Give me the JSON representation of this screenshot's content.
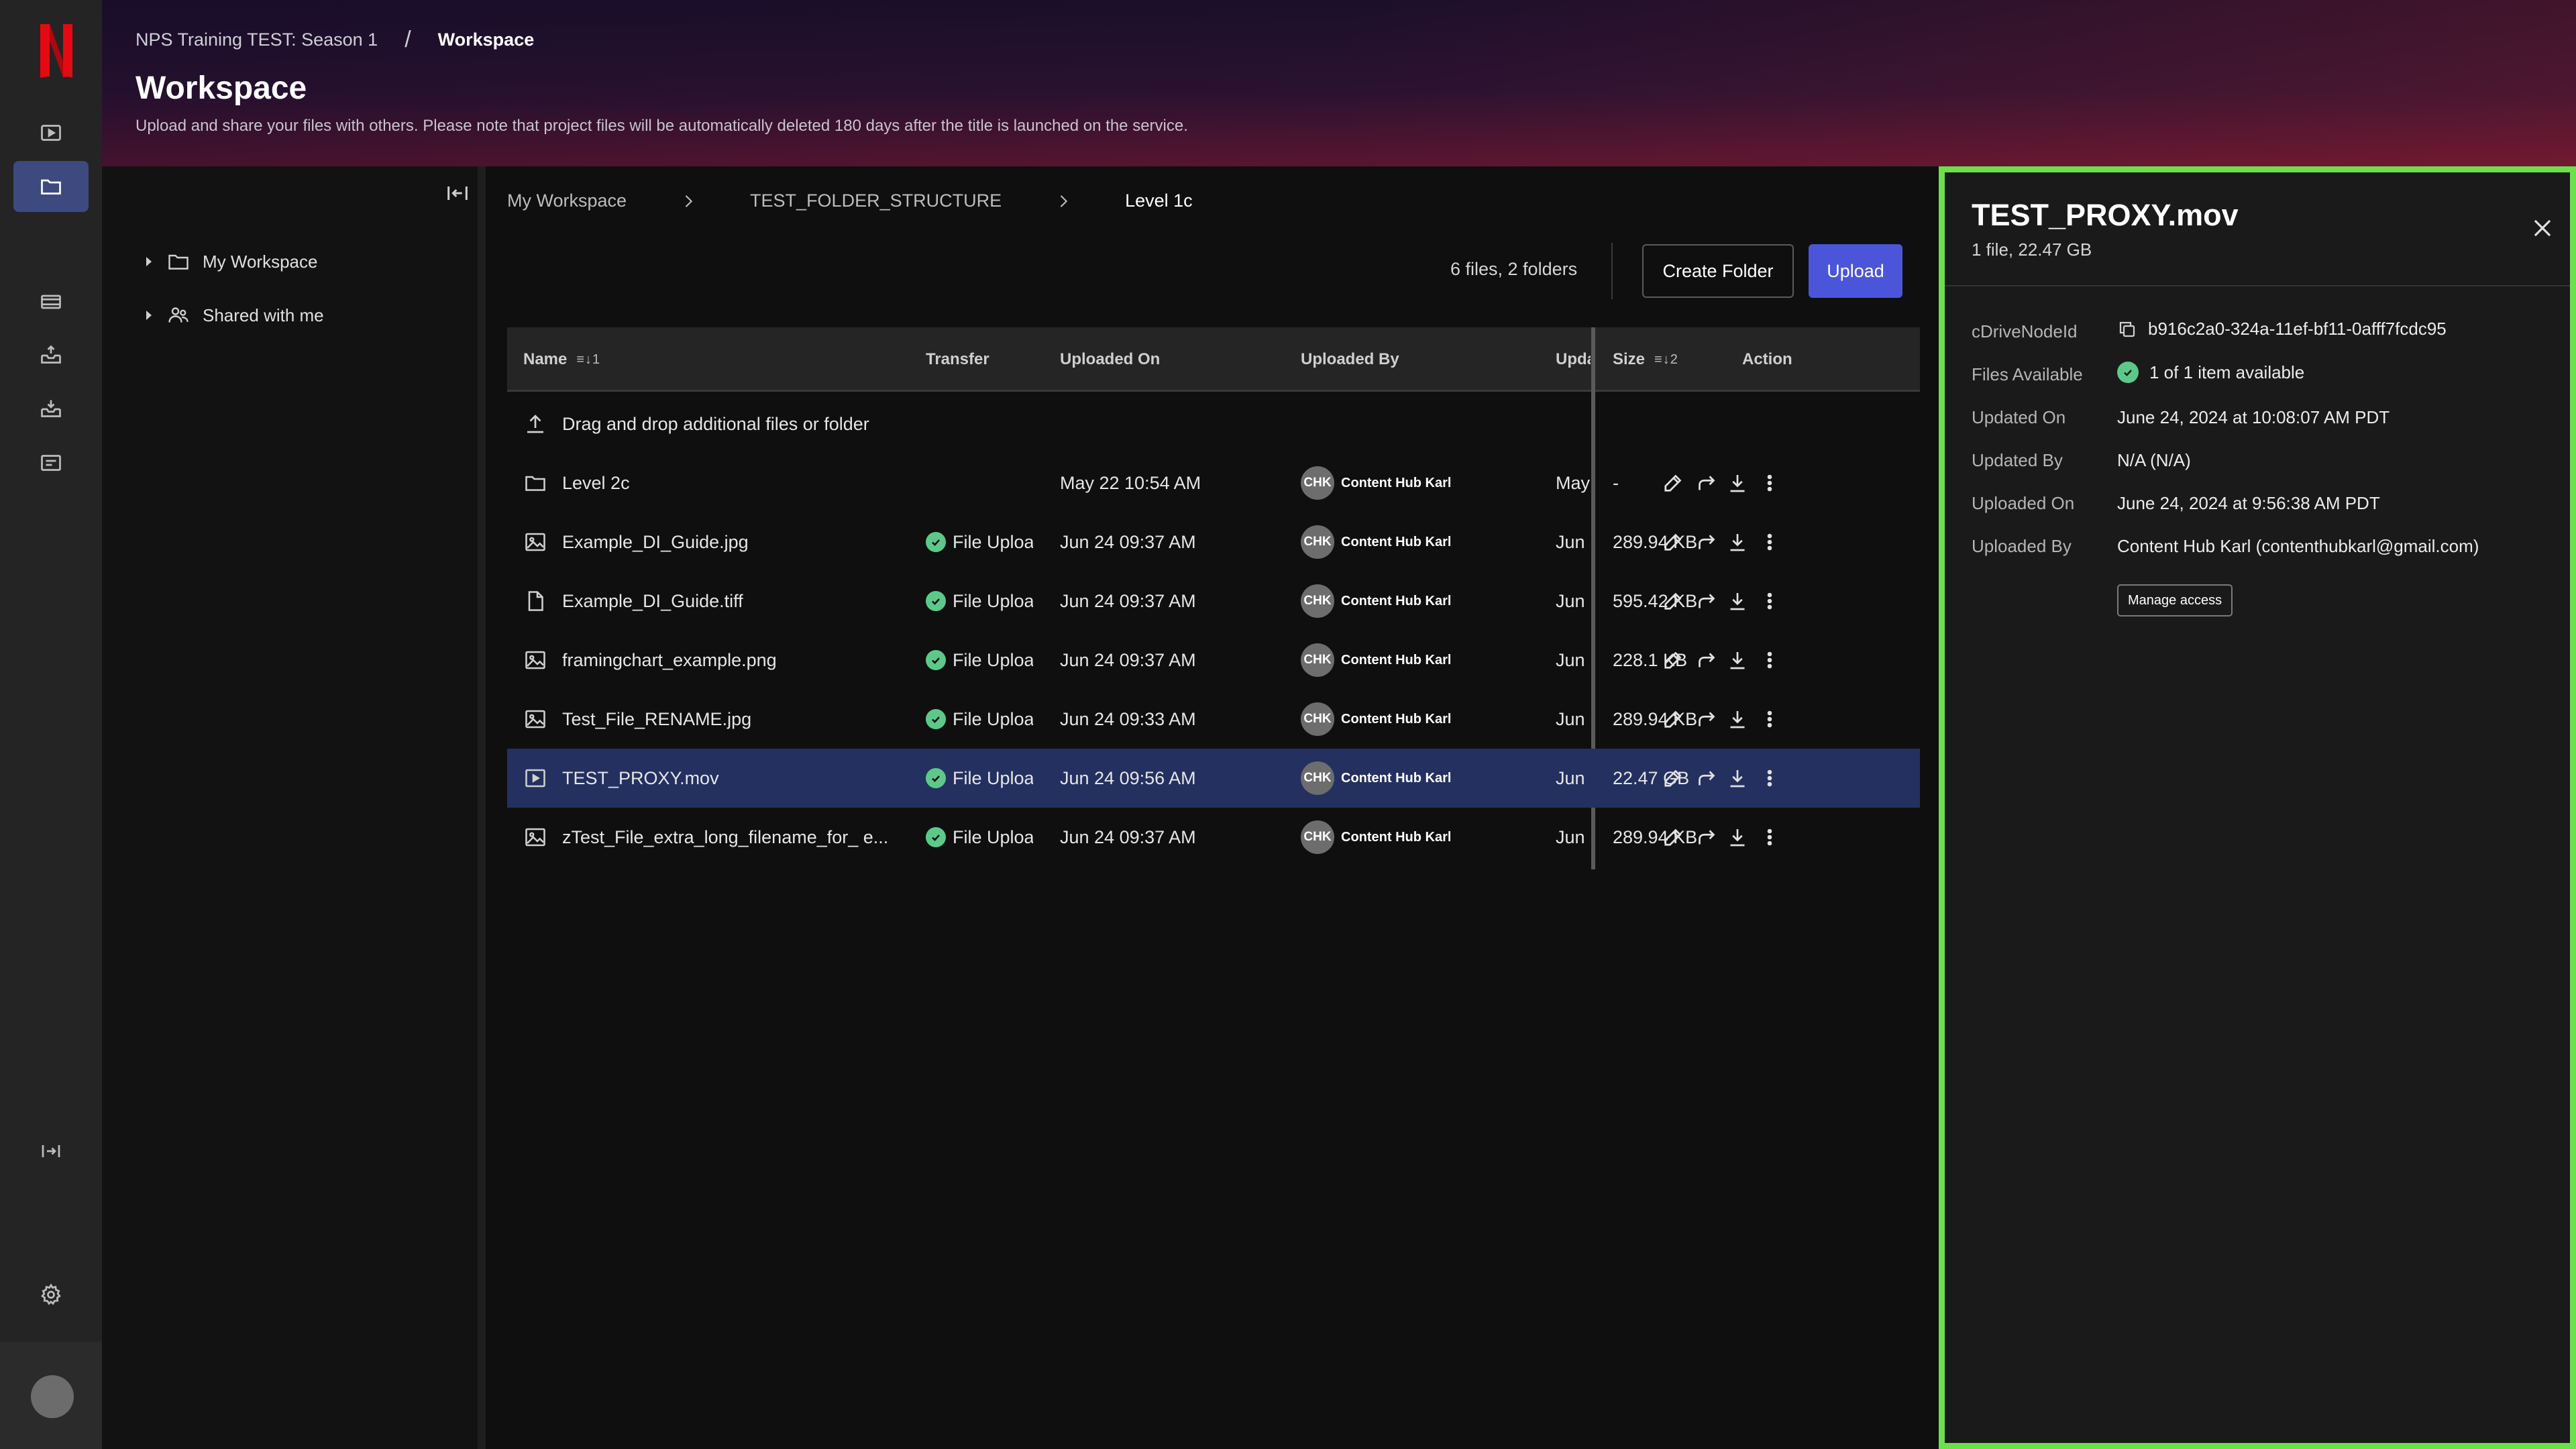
{
  "app": {
    "breadcrumb": {
      "project": "NPS Training TEST: Season 1",
      "separator": "/",
      "current": "Workspace"
    },
    "title": "Workspace",
    "subtitle": "Upload and share your files with others. Please note that project files will be automatically deleted 180 days after the title is launched on the service.",
    "brand_color": "#e50914",
    "accent_color": "#4a55d9",
    "highlight_color": "#6be04a"
  },
  "sidebar": {
    "logo_letter": "N",
    "items": [
      {
        "icon": "play-icon",
        "active": false
      },
      {
        "icon": "folder-icon",
        "active": true
      },
      {
        "icon": "film-icon",
        "active": false
      },
      {
        "icon": "inbox-upload-icon",
        "active": false
      },
      {
        "icon": "inbox-download-icon",
        "active": false
      },
      {
        "icon": "tray-icon",
        "active": false
      },
      {
        "icon": "expand-panel-icon",
        "active": false
      },
      {
        "icon": "gear-icon",
        "active": false
      }
    ]
  },
  "tree": {
    "items": [
      {
        "label": "My Workspace",
        "icon": "folder-icon"
      },
      {
        "label": "Shared with me",
        "icon": "people-icon"
      }
    ]
  },
  "main": {
    "crumbs": [
      "My Workspace",
      "TEST_FOLDER_STRUCTURE",
      "Level 1c"
    ],
    "count_text": "6 files, 2 folders",
    "create_folder_label": "Create Folder",
    "upload_label": "Upload",
    "columns": {
      "name": "Name",
      "name_sort": "1",
      "transfer": "Transfer",
      "uploaded_on": "Uploaded On",
      "uploaded_by": "Uploaded By",
      "updated": "Upda",
      "size": "Size",
      "size_sort": "2",
      "action": "Action"
    },
    "dropzone_text": "Drag and drop additional files or folder",
    "rows": [
      {
        "name": "Level 2c",
        "icon": "folder-icon",
        "transfer": "",
        "uploaded_on": "May 22 10:54 AM",
        "uploader_initials": "CHK",
        "uploader": "Content Hub Karl",
        "updated": "May",
        "size": "-",
        "selected": false
      },
      {
        "name": "Example_DI_Guide.jpg",
        "icon": "image-icon",
        "transfer": "File Uploa",
        "uploaded_on": "Jun 24 09:37 AM",
        "uploader_initials": "CHK",
        "uploader": "Content Hub Karl",
        "updated": "Jun",
        "size": "289.94 KB",
        "selected": false
      },
      {
        "name": "Example_DI_Guide.tiff",
        "icon": "document-icon",
        "transfer": "File Uploa",
        "uploaded_on": "Jun 24 09:37 AM",
        "uploader_initials": "CHK",
        "uploader": "Content Hub Karl",
        "updated": "Jun",
        "size": "595.42 KB",
        "selected": false
      },
      {
        "name": "framingchart_example.png",
        "icon": "image-icon",
        "transfer": "File Uploa",
        "uploaded_on": "Jun 24 09:37 AM",
        "uploader_initials": "CHK",
        "uploader": "Content Hub Karl",
        "updated": "Jun",
        "size": "228.1 KB",
        "selected": false
      },
      {
        "name": "Test_File_RENAME.jpg",
        "icon": "image-icon",
        "transfer": "File Uploa",
        "uploaded_on": "Jun 24 09:33 AM",
        "uploader_initials": "CHK",
        "uploader": "Content Hub Karl",
        "updated": "Jun",
        "size": "289.94 KB",
        "selected": false
      },
      {
        "name": "TEST_PROXY.mov",
        "icon": "video-icon",
        "transfer": "File Uploa",
        "uploaded_on": "Jun 24 09:56 AM",
        "uploader_initials": "CHK",
        "uploader": "Content Hub Karl",
        "updated": "Jun",
        "size": "22.47 GB",
        "selected": true
      },
      {
        "name": "zTest_File_extra_long_filename_for_ e...",
        "icon": "image-icon",
        "transfer": "File Uploa",
        "uploaded_on": "Jun 24 09:37 AM",
        "uploader_initials": "CHK",
        "uploader": "Content Hub Karl",
        "updated": "Jun",
        "size": "289.94 KB",
        "selected": false
      }
    ]
  },
  "details": {
    "title": "TEST_PROXY.mov",
    "subtitle": "1 file, 22.47 GB",
    "fields": [
      {
        "label": "cDriveNodeId",
        "value": "b916c2a0-324a-11ef-bf11-0afff7fcdc95"
      },
      {
        "label": "Files Available",
        "value": "1 of 1 item available"
      },
      {
        "label": "Updated On",
        "value": "June 24, 2024 at 10:08:07 AM PDT"
      },
      {
        "label": "Updated By",
        "value": "N/A (N/A)"
      },
      {
        "label": "Uploaded On",
        "value": "June 24, 2024 at 9:56:38 AM PDT"
      },
      {
        "label": "Uploaded By",
        "value": "Content Hub Karl (contenthubkarl@gmail.com)"
      }
    ],
    "manage_access_label": "Manage access"
  }
}
